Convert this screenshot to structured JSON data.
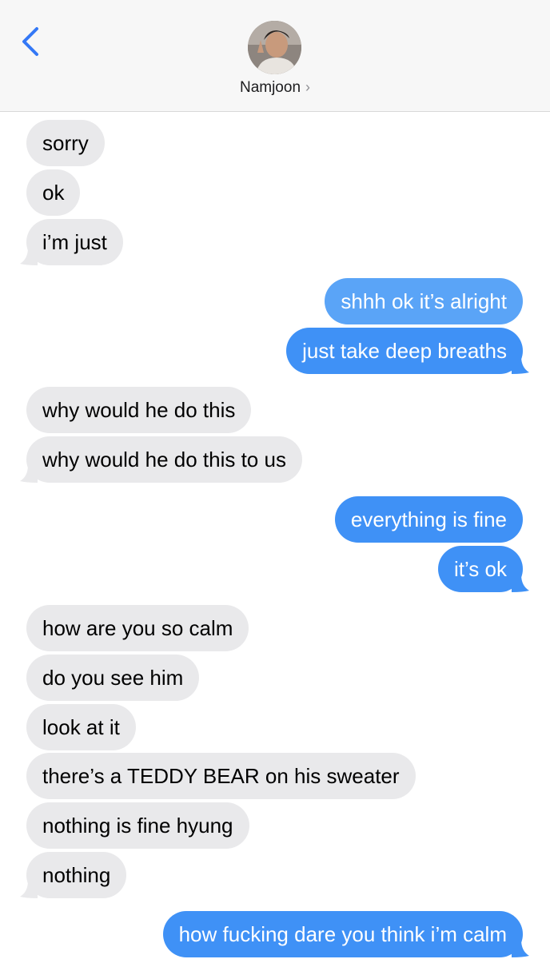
{
  "header": {
    "contact_name": "Namjoon",
    "back_icon": "chevron-left-icon",
    "chevron_icon": "chevron-right-icon",
    "accent_color": "#3478f6"
  },
  "colors": {
    "received_bubble": "#e9e9eb",
    "sent_bubble": "#3f91f6"
  },
  "messages": [
    {
      "from": "them",
      "text": "sorry"
    },
    {
      "from": "them",
      "text": "ok"
    },
    {
      "from": "them",
      "text": "i’m just"
    },
    {
      "from": "me",
      "text": "shhh ok it’s alright"
    },
    {
      "from": "me",
      "text": "just take deep breaths"
    },
    {
      "from": "them",
      "text": "why would he do this"
    },
    {
      "from": "them",
      "text": "why would he do this to us"
    },
    {
      "from": "me",
      "text": "everything is fine"
    },
    {
      "from": "me",
      "text": "it’s ok"
    },
    {
      "from": "them",
      "text": "how are you so calm"
    },
    {
      "from": "them",
      "text": "do you see him"
    },
    {
      "from": "them",
      "text": "look at it"
    },
    {
      "from": "them",
      "text": "there’s a TEDDY BEAR on his sweater"
    },
    {
      "from": "them",
      "text": "nothing is fine hyung"
    },
    {
      "from": "them",
      "text": "nothing"
    },
    {
      "from": "me",
      "text": "how fucking dare you think i’m calm"
    }
  ]
}
